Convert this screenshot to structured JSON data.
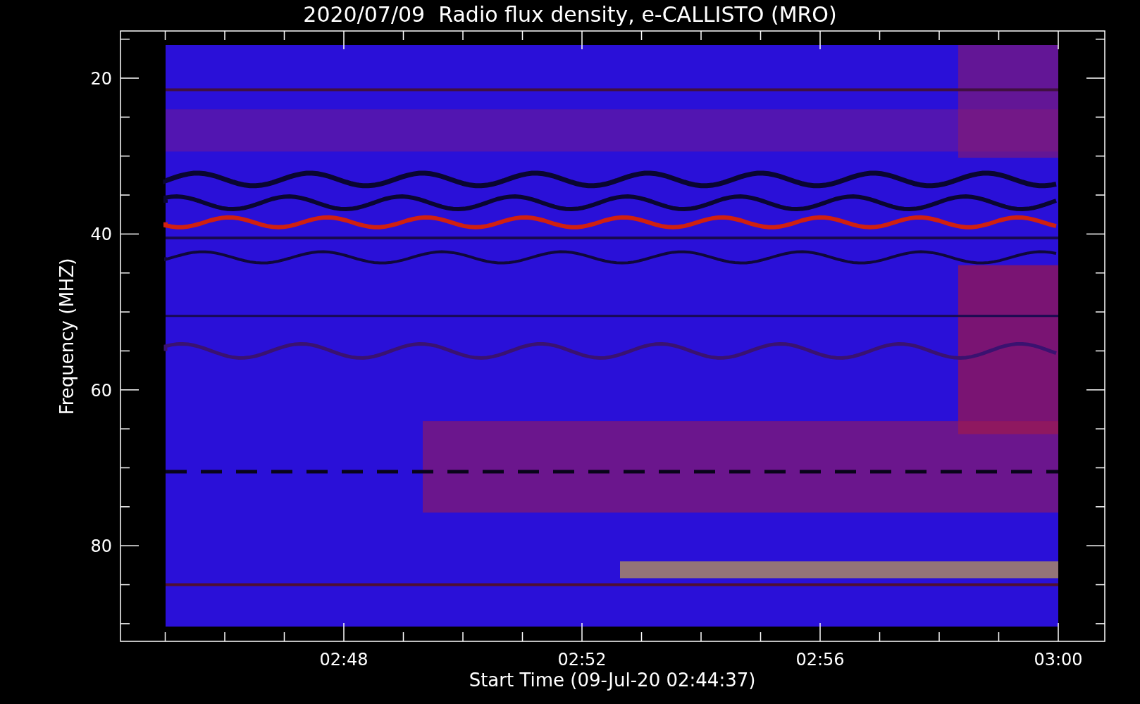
{
  "plot": {
    "title": "2020/07/09  Radio flux density, e-CALLISTO (MRO)",
    "ylabel": "Frequency (MHZ)",
    "xlabel": "Start Time (09-Jul-20 02:44:37)",
    "yticks": [
      "20",
      "40",
      "60",
      "80"
    ],
    "xticks": [
      "02:48",
      "02:52",
      "02:56",
      "03:00"
    ]
  }
}
